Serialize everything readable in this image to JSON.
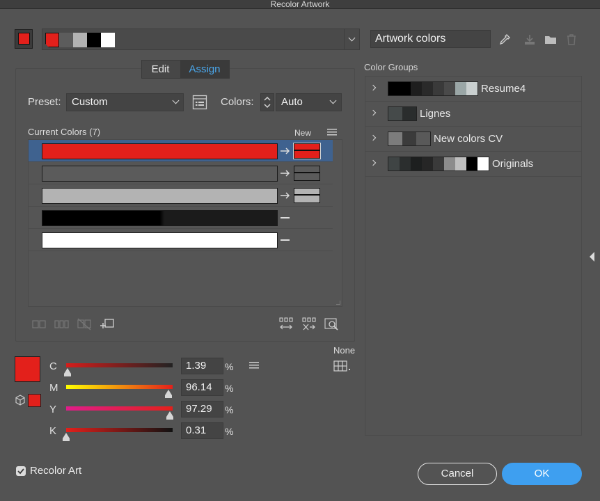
{
  "window": {
    "title": "Recolor Artwork"
  },
  "top_bar": {
    "swatch_color": "#e3201b",
    "strip_colors": [
      "#e3201b",
      "#5c5c5c",
      "#b3b3b3",
      "#000000",
      "#ffffff"
    ],
    "group_name": "Artwork colors"
  },
  "tabs": [
    {
      "label": "Edit",
      "active": false
    },
    {
      "label": "Assign",
      "active": true
    }
  ],
  "preset": {
    "label": "Preset:",
    "value": "Custom"
  },
  "colors": {
    "label": "Colors:",
    "value": "Auto"
  },
  "table": {
    "header_current": "Current Colors (7)",
    "header_new": "New",
    "rows": [
      {
        "current": "#e3201b",
        "new": "#e3201b",
        "selected": true,
        "mapped": true
      },
      {
        "current": "#5b5b5b",
        "new": "#5b5b5b",
        "selected": false,
        "mapped": true
      },
      {
        "current": "#b3b3b3",
        "new": "#b3b3b3",
        "selected": false,
        "mapped": true
      },
      {
        "current_left": "#000000",
        "current_right": "#1b1b1b",
        "selected": false,
        "mapped": false
      },
      {
        "current": "#ffffff",
        "selected": false,
        "mapped": false
      }
    ]
  },
  "none_label": "None",
  "cmyk": {
    "color": "#e3201b",
    "channels": [
      {
        "label": "C",
        "value": "1.39",
        "percent": 1.39,
        "gradient": [
          "#d51e1b",
          "#222222"
        ]
      },
      {
        "label": "M",
        "value": "96.14",
        "percent": 96.14,
        "gradient": [
          "#ffff00",
          "#e3201b"
        ]
      },
      {
        "label": "Y",
        "value": "97.29",
        "percent": 97.29,
        "gradient": [
          "#e01d8a",
          "#e3201b"
        ]
      },
      {
        "label": "K",
        "value": "0.31",
        "percent": 0.31,
        "gradient": [
          "#e3201b",
          "#111111"
        ]
      }
    ],
    "unit": "%"
  },
  "color_groups": {
    "title": "Color Groups",
    "groups": [
      {
        "name": "Resume4",
        "colors": [
          "#000000",
          "#000000",
          "#1e1e1e",
          "#2a2a2a",
          "#3a3a3a",
          "#4a4a4a",
          "#9aa6a6",
          "#c9cfcf"
        ]
      },
      {
        "name": "Lignes",
        "colors": [
          "#454a4a",
          "#2a2d2d"
        ]
      },
      {
        "name": "New colors CV",
        "colors": [
          "#7c7c7c",
          "#3b3b3b",
          "#595959"
        ]
      },
      {
        "name": "Originals",
        "colors": [
          "#3f4444",
          "#2b2e2e",
          "#1d1f1f",
          "#262626",
          "#3a3a3a",
          "#8c8c8c",
          "#bfbfbf",
          "#000000",
          "#ffffff"
        ]
      }
    ]
  },
  "footer": {
    "recolor_art_label": "Recolor Art",
    "recolor_art_checked": true,
    "cancel_label": "Cancel",
    "ok_label": "OK"
  }
}
